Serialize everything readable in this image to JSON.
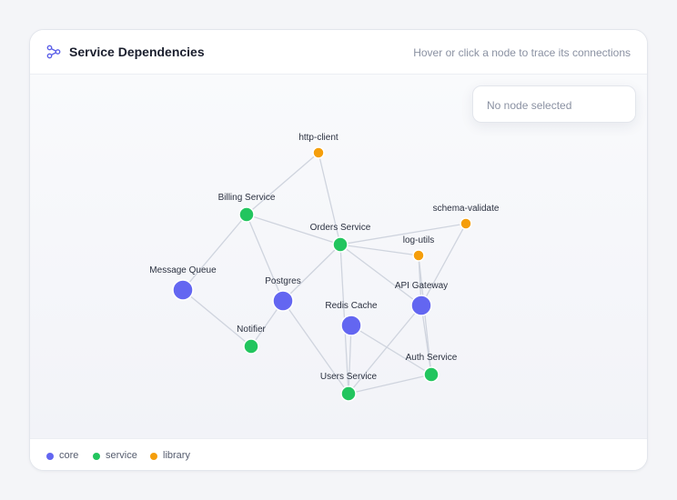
{
  "header": {
    "title": "Service Dependencies",
    "hint": "Hover or click a node to trace its connections"
  },
  "info_panel": {
    "text": "No node selected"
  },
  "colors": {
    "core": "#6366f1",
    "service": "#22c55e",
    "library": "#f59e0b",
    "edge": "#cfd4de"
  },
  "legend": [
    {
      "label": "core",
      "color": "#6366f1"
    },
    {
      "label": "service",
      "color": "#22c55e"
    },
    {
      "label": "library",
      "color": "#f59e0b"
    }
  ],
  "graph": {
    "nodes": [
      {
        "id": "http-client",
        "label": "http-client",
        "group": "library"
      },
      {
        "id": "billing",
        "label": "Billing Service",
        "group": "service"
      },
      {
        "id": "orders",
        "label": "Orders Service",
        "group": "service"
      },
      {
        "id": "schema",
        "label": "schema-validate",
        "group": "library"
      },
      {
        "id": "logutils",
        "label": "log-utils",
        "group": "library"
      },
      {
        "id": "mq",
        "label": "Message Queue",
        "group": "core"
      },
      {
        "id": "postgres",
        "label": "Postgres",
        "group": "core"
      },
      {
        "id": "gateway",
        "label": "API Gateway",
        "group": "core"
      },
      {
        "id": "redis",
        "label": "Redis Cache",
        "group": "core"
      },
      {
        "id": "notifier",
        "label": "Notifier",
        "group": "service"
      },
      {
        "id": "auth",
        "label": "Auth Service",
        "group": "service"
      },
      {
        "id": "users",
        "label": "Users Service",
        "group": "service"
      }
    ],
    "edges": [
      [
        "http-client",
        "billing"
      ],
      [
        "http-client",
        "orders"
      ],
      [
        "billing",
        "orders"
      ],
      [
        "billing",
        "mq"
      ],
      [
        "billing",
        "postgres"
      ],
      [
        "orders",
        "schema"
      ],
      [
        "orders",
        "logutils"
      ],
      [
        "orders",
        "gateway"
      ],
      [
        "orders",
        "postgres"
      ],
      [
        "orders",
        "users"
      ],
      [
        "schema",
        "gateway"
      ],
      [
        "logutils",
        "gateway"
      ],
      [
        "logutils",
        "auth"
      ],
      [
        "mq",
        "notifier"
      ],
      [
        "postgres",
        "notifier"
      ],
      [
        "postgres",
        "users"
      ],
      [
        "gateway",
        "auth"
      ],
      [
        "gateway",
        "users"
      ],
      [
        "redis",
        "users"
      ],
      [
        "redis",
        "auth"
      ],
      [
        "users",
        "auth"
      ]
    ]
  }
}
